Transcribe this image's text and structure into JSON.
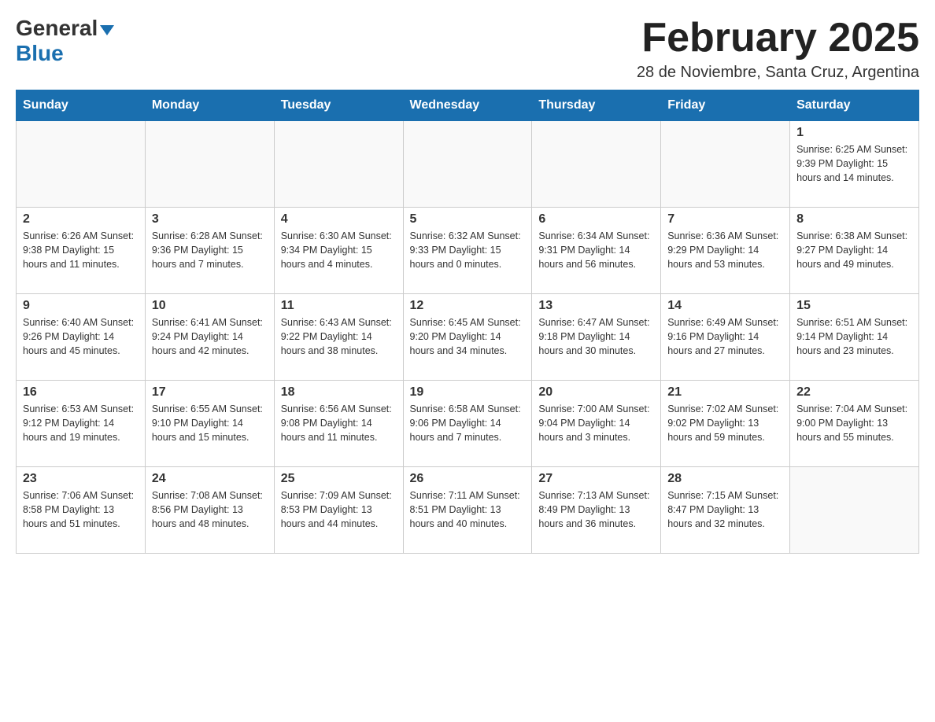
{
  "header": {
    "logo_general": "General",
    "logo_blue": "Blue",
    "month_title": "February 2025",
    "location": "28 de Noviembre, Santa Cruz, Argentina"
  },
  "weekdays": [
    "Sunday",
    "Monday",
    "Tuesday",
    "Wednesday",
    "Thursday",
    "Friday",
    "Saturday"
  ],
  "weeks": [
    [
      {
        "day": "",
        "info": ""
      },
      {
        "day": "",
        "info": ""
      },
      {
        "day": "",
        "info": ""
      },
      {
        "day": "",
        "info": ""
      },
      {
        "day": "",
        "info": ""
      },
      {
        "day": "",
        "info": ""
      },
      {
        "day": "1",
        "info": "Sunrise: 6:25 AM\nSunset: 9:39 PM\nDaylight: 15 hours and 14 minutes."
      }
    ],
    [
      {
        "day": "2",
        "info": "Sunrise: 6:26 AM\nSunset: 9:38 PM\nDaylight: 15 hours and 11 minutes."
      },
      {
        "day": "3",
        "info": "Sunrise: 6:28 AM\nSunset: 9:36 PM\nDaylight: 15 hours and 7 minutes."
      },
      {
        "day": "4",
        "info": "Sunrise: 6:30 AM\nSunset: 9:34 PM\nDaylight: 15 hours and 4 minutes."
      },
      {
        "day": "5",
        "info": "Sunrise: 6:32 AM\nSunset: 9:33 PM\nDaylight: 15 hours and 0 minutes."
      },
      {
        "day": "6",
        "info": "Sunrise: 6:34 AM\nSunset: 9:31 PM\nDaylight: 14 hours and 56 minutes."
      },
      {
        "day": "7",
        "info": "Sunrise: 6:36 AM\nSunset: 9:29 PM\nDaylight: 14 hours and 53 minutes."
      },
      {
        "day": "8",
        "info": "Sunrise: 6:38 AM\nSunset: 9:27 PM\nDaylight: 14 hours and 49 minutes."
      }
    ],
    [
      {
        "day": "9",
        "info": "Sunrise: 6:40 AM\nSunset: 9:26 PM\nDaylight: 14 hours and 45 minutes."
      },
      {
        "day": "10",
        "info": "Sunrise: 6:41 AM\nSunset: 9:24 PM\nDaylight: 14 hours and 42 minutes."
      },
      {
        "day": "11",
        "info": "Sunrise: 6:43 AM\nSunset: 9:22 PM\nDaylight: 14 hours and 38 minutes."
      },
      {
        "day": "12",
        "info": "Sunrise: 6:45 AM\nSunset: 9:20 PM\nDaylight: 14 hours and 34 minutes."
      },
      {
        "day": "13",
        "info": "Sunrise: 6:47 AM\nSunset: 9:18 PM\nDaylight: 14 hours and 30 minutes."
      },
      {
        "day": "14",
        "info": "Sunrise: 6:49 AM\nSunset: 9:16 PM\nDaylight: 14 hours and 27 minutes."
      },
      {
        "day": "15",
        "info": "Sunrise: 6:51 AM\nSunset: 9:14 PM\nDaylight: 14 hours and 23 minutes."
      }
    ],
    [
      {
        "day": "16",
        "info": "Sunrise: 6:53 AM\nSunset: 9:12 PM\nDaylight: 14 hours and 19 minutes."
      },
      {
        "day": "17",
        "info": "Sunrise: 6:55 AM\nSunset: 9:10 PM\nDaylight: 14 hours and 15 minutes."
      },
      {
        "day": "18",
        "info": "Sunrise: 6:56 AM\nSunset: 9:08 PM\nDaylight: 14 hours and 11 minutes."
      },
      {
        "day": "19",
        "info": "Sunrise: 6:58 AM\nSunset: 9:06 PM\nDaylight: 14 hours and 7 minutes."
      },
      {
        "day": "20",
        "info": "Sunrise: 7:00 AM\nSunset: 9:04 PM\nDaylight: 14 hours and 3 minutes."
      },
      {
        "day": "21",
        "info": "Sunrise: 7:02 AM\nSunset: 9:02 PM\nDaylight: 13 hours and 59 minutes."
      },
      {
        "day": "22",
        "info": "Sunrise: 7:04 AM\nSunset: 9:00 PM\nDaylight: 13 hours and 55 minutes."
      }
    ],
    [
      {
        "day": "23",
        "info": "Sunrise: 7:06 AM\nSunset: 8:58 PM\nDaylight: 13 hours and 51 minutes."
      },
      {
        "day": "24",
        "info": "Sunrise: 7:08 AM\nSunset: 8:56 PM\nDaylight: 13 hours and 48 minutes."
      },
      {
        "day": "25",
        "info": "Sunrise: 7:09 AM\nSunset: 8:53 PM\nDaylight: 13 hours and 44 minutes."
      },
      {
        "day": "26",
        "info": "Sunrise: 7:11 AM\nSunset: 8:51 PM\nDaylight: 13 hours and 40 minutes."
      },
      {
        "day": "27",
        "info": "Sunrise: 7:13 AM\nSunset: 8:49 PM\nDaylight: 13 hours and 36 minutes."
      },
      {
        "day": "28",
        "info": "Sunrise: 7:15 AM\nSunset: 8:47 PM\nDaylight: 13 hours and 32 minutes."
      },
      {
        "day": "",
        "info": ""
      }
    ]
  ]
}
